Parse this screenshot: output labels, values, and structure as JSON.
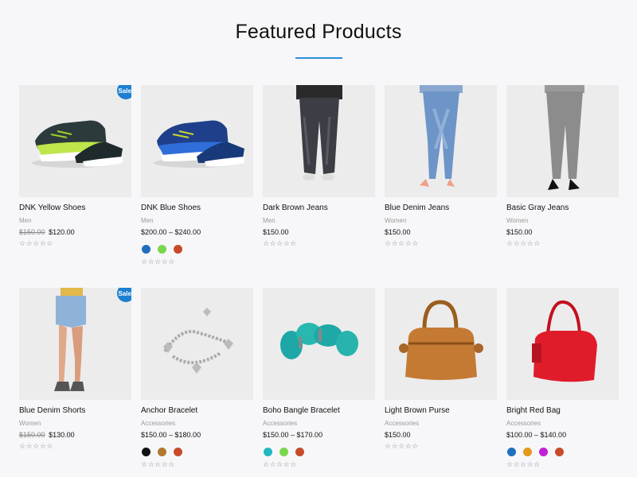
{
  "section": {
    "title": "Featured Products"
  },
  "products": [
    {
      "name": "DNK Yellow Shoes",
      "category": "Men",
      "old_price": "$150.00",
      "price": "$120.00",
      "sale": "Sale!",
      "rating": "☆☆☆☆☆",
      "image_icon": "sneaker-yellow",
      "swatches": []
    },
    {
      "name": "DNK Blue Shoes",
      "category": "Men",
      "old_price": "",
      "price": "$200.00 – $240.00",
      "sale": "",
      "rating": "☆☆☆☆☆",
      "image_icon": "sneaker-blue",
      "swatches": [
        "#1f6fc0",
        "#77d84c",
        "#c84a2a"
      ]
    },
    {
      "name": "Dark Brown Jeans",
      "category": "Men",
      "old_price": "",
      "price": "$150.00",
      "sale": "",
      "rating": "☆☆☆☆☆",
      "image_icon": "jeans-dark",
      "swatches": []
    },
    {
      "name": "Blue Denim Jeans",
      "category": "Women",
      "old_price": "",
      "price": "$150.00",
      "sale": "",
      "rating": "☆☆☆☆☆",
      "image_icon": "jeans-blue",
      "swatches": []
    },
    {
      "name": "Basic Gray Jeans",
      "category": "Women",
      "old_price": "",
      "price": "$150.00",
      "sale": "",
      "rating": "☆☆☆☆☆",
      "image_icon": "jeans-gray",
      "swatches": []
    },
    {
      "name": "Blue Denim Shorts",
      "category": "Women",
      "old_price": "$150.00",
      "price": "$130.00",
      "sale": "Sale!",
      "rating": "☆☆☆☆☆",
      "image_icon": "shorts-denim",
      "swatches": []
    },
    {
      "name": "Anchor Bracelet",
      "category": "Accessories",
      "old_price": "",
      "price": "$150.00 – $180.00",
      "sale": "",
      "rating": "☆☆☆☆☆",
      "image_icon": "bracelet-silver",
      "swatches": [
        "#111111",
        "#b07a2c",
        "#c84a2a"
      ]
    },
    {
      "name": "Boho Bangle Bracelet",
      "category": "Accessories",
      "old_price": "",
      "price": "$150.00 – $170.00",
      "sale": "",
      "rating": "☆☆☆☆☆",
      "image_icon": "bracelet-turquoise",
      "swatches": [
        "#22b8c2",
        "#77d84c",
        "#c84a2a"
      ]
    },
    {
      "name": "Light Brown Purse",
      "category": "Accessories",
      "old_price": "",
      "price": "$150.00",
      "sale": "",
      "rating": "☆☆☆☆☆",
      "image_icon": "purse-brown",
      "swatches": []
    },
    {
      "name": "Bright Red Bag",
      "category": "Accessories",
      "old_price": "",
      "price": "$100.00 – $140.00",
      "sale": "",
      "rating": "☆☆☆☆☆",
      "image_icon": "bag-red",
      "swatches": [
        "#1f6fc0",
        "#e39a1c",
        "#c21fd6",
        "#c84a2a"
      ]
    }
  ],
  "colors": {
    "accent": "#2b8fd6",
    "sale_badge": "#1e7fd0"
  }
}
